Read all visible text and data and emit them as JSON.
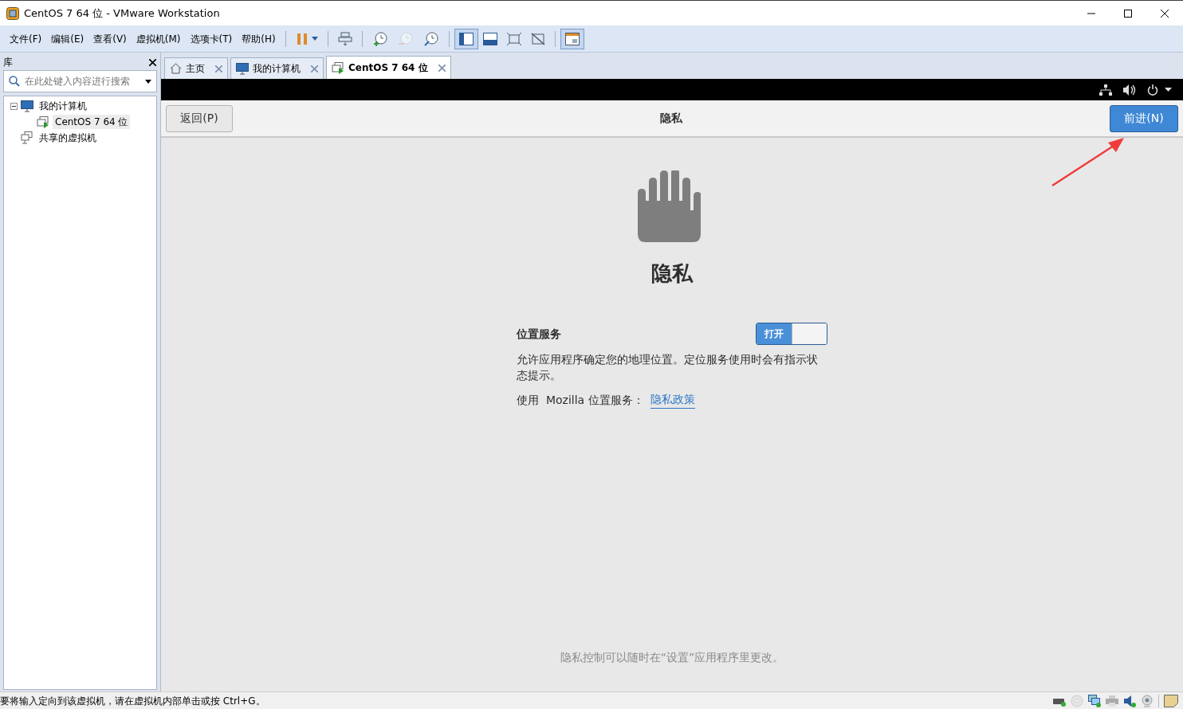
{
  "window": {
    "title": "CentOS 7 64 位 - VMware Workstation"
  },
  "menu": [
    "文件(F)",
    "编辑(E)",
    "查看(V)",
    "虚拟机(M)",
    "选项卡(T)",
    "帮助(H)"
  ],
  "toolbar": [
    {
      "kind": "suspend",
      "pressed": false,
      "disabled": false
    },
    {
      "kind": "send-keys",
      "pressed": false,
      "disabled": false
    },
    {
      "kind": "snapshot",
      "pressed": false,
      "disabled": false
    },
    {
      "kind": "revert",
      "pressed": false,
      "disabled": true
    },
    {
      "kind": "manage-snapshots",
      "pressed": false,
      "disabled": false
    },
    {
      "kind": "sidebar-view",
      "pressed": true,
      "disabled": false
    },
    {
      "kind": "thumbnail-view",
      "pressed": false,
      "disabled": false
    },
    {
      "kind": "fullscreen",
      "pressed": false,
      "disabled": false
    },
    {
      "kind": "unity",
      "pressed": false,
      "disabled": false
    },
    {
      "kind": "console-view",
      "pressed": true,
      "disabled": false
    }
  ],
  "sidebar": {
    "title": "库",
    "search": {
      "placeholder": "在此处键入内容进行搜索"
    },
    "tree": [
      {
        "label": "我的计算机",
        "kind": "computer",
        "expanded": true,
        "selected": false,
        "children": [
          {
            "label": "CentOS 7 64 位",
            "kind": "vm",
            "selected": true
          }
        ]
      },
      {
        "label": "共享的虚拟机",
        "kind": "shared",
        "selected": false
      }
    ]
  },
  "tabs": [
    {
      "label": "主页",
      "kind": "home",
      "selected": false
    },
    {
      "label": "我的计算机",
      "kind": "computer",
      "selected": false
    },
    {
      "label": "CentOS 7 64 位",
      "kind": "vm",
      "selected": true
    }
  ],
  "guest": {
    "header": {
      "back_button": "返回(P)",
      "title": "隐私",
      "next_button": "前进(N)"
    },
    "heading": "隐私",
    "location": {
      "label": "位置服务",
      "toggle": {
        "label": "打开",
        "on": true
      },
      "description": "允许应用程序确定您的地理位置。定位服务使用时会有指示状态提示。",
      "usage_text": "使用  Mozilla 位置服务：",
      "link": "隐私政策"
    },
    "footer_note": "隐私控制可以随时在“设置”应用程序里更改。"
  },
  "status_bar": {
    "message": "要将输入定向到该虚拟机，请在虚拟机内部单击或按 Ctrl+G。"
  }
}
